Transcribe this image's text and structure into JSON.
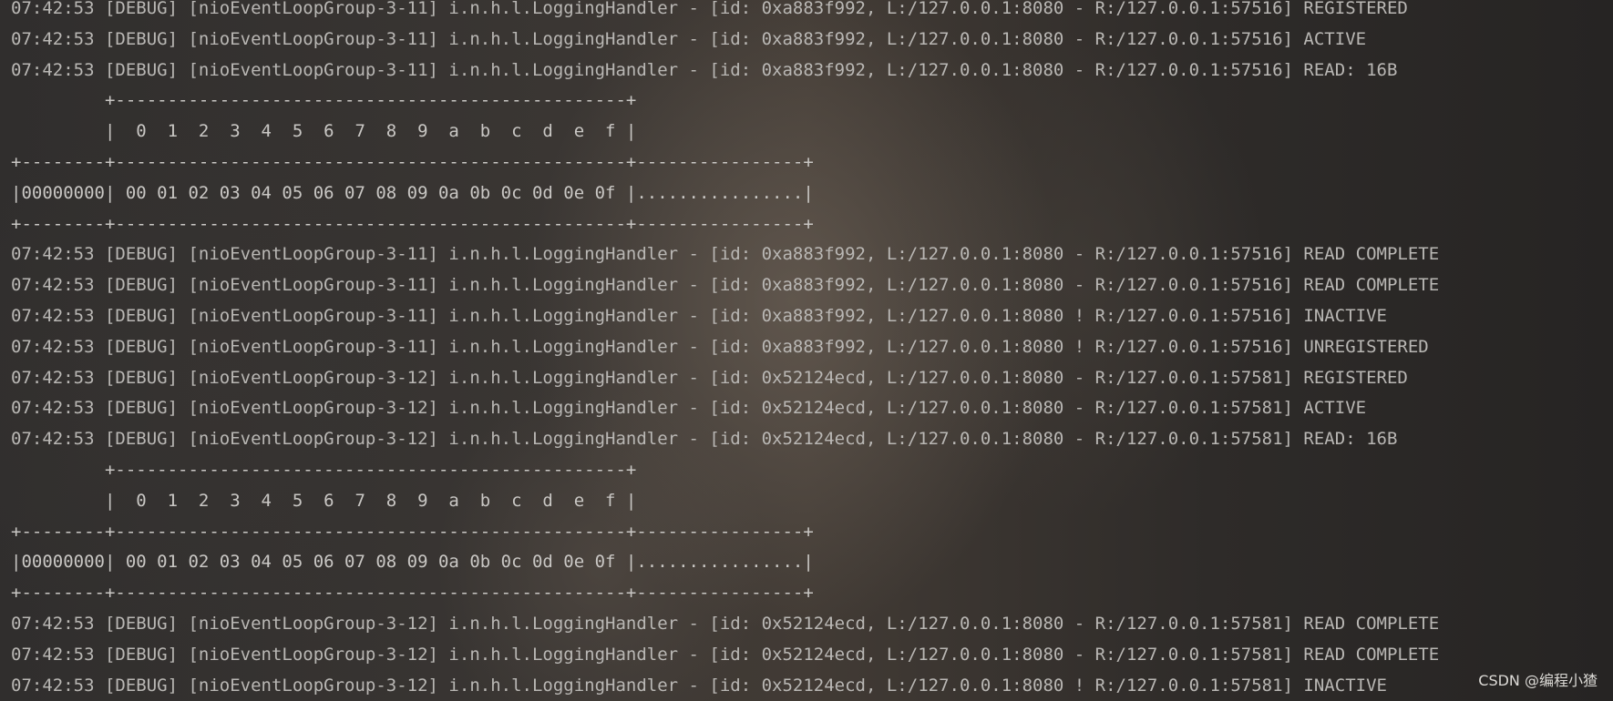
{
  "console": {
    "lines": [
      "07:42:53 [DEBUG] [nioEventLoopGroup-3-11] i.n.h.l.LoggingHandler - [id: 0xa883f992, L:/127.0.0.1:8080 - R:/127.0.0.1:57516] REGISTERED",
      "07:42:53 [DEBUG] [nioEventLoopGroup-3-11] i.n.h.l.LoggingHandler - [id: 0xa883f992, L:/127.0.0.1:8080 - R:/127.0.0.1:57516] ACTIVE",
      "07:42:53 [DEBUG] [nioEventLoopGroup-3-11] i.n.h.l.LoggingHandler - [id: 0xa883f992, L:/127.0.0.1:8080 - R:/127.0.0.1:57516] READ: 16B",
      "         +-------------------------------------------------+",
      "         |  0  1  2  3  4  5  6  7  8  9  a  b  c  d  e  f |",
      "+--------+-------------------------------------------------+----------------+",
      "|00000000| 00 01 02 03 04 05 06 07 08 09 0a 0b 0c 0d 0e 0f |................|",
      "+--------+-------------------------------------------------+----------------+",
      "07:42:53 [DEBUG] [nioEventLoopGroup-3-11] i.n.h.l.LoggingHandler - [id: 0xa883f992, L:/127.0.0.1:8080 - R:/127.0.0.1:57516] READ COMPLETE",
      "07:42:53 [DEBUG] [nioEventLoopGroup-3-11] i.n.h.l.LoggingHandler - [id: 0xa883f992, L:/127.0.0.1:8080 - R:/127.0.0.1:57516] READ COMPLETE",
      "07:42:53 [DEBUG] [nioEventLoopGroup-3-11] i.n.h.l.LoggingHandler - [id: 0xa883f992, L:/127.0.0.1:8080 ! R:/127.0.0.1:57516] INACTIVE",
      "07:42:53 [DEBUG] [nioEventLoopGroup-3-11] i.n.h.l.LoggingHandler - [id: 0xa883f992, L:/127.0.0.1:8080 ! R:/127.0.0.1:57516] UNREGISTERED",
      "07:42:53 [DEBUG] [nioEventLoopGroup-3-12] i.n.h.l.LoggingHandler - [id: 0x52124ecd, L:/127.0.0.1:8080 - R:/127.0.0.1:57581] REGISTERED",
      "07:42:53 [DEBUG] [nioEventLoopGroup-3-12] i.n.h.l.LoggingHandler - [id: 0x52124ecd, L:/127.0.0.1:8080 - R:/127.0.0.1:57581] ACTIVE",
      "07:42:53 [DEBUG] [nioEventLoopGroup-3-12] i.n.h.l.LoggingHandler - [id: 0x52124ecd, L:/127.0.0.1:8080 - R:/127.0.0.1:57581] READ: 16B",
      "         +-------------------------------------------------+",
      "         |  0  1  2  3  4  5  6  7  8  9  a  b  c  d  e  f |",
      "+--------+-------------------------------------------------+----------------+",
      "|00000000| 00 01 02 03 04 05 06 07 08 09 0a 0b 0c 0d 0e 0f |................|",
      "+--------+-------------------------------------------------+----------------+",
      "07:42:53 [DEBUG] [nioEventLoopGroup-3-12] i.n.h.l.LoggingHandler - [id: 0x52124ecd, L:/127.0.0.1:8080 - R:/127.0.0.1:57581] READ COMPLETE",
      "07:42:53 [DEBUG] [nioEventLoopGroup-3-12] i.n.h.l.LoggingHandler - [id: 0x52124ecd, L:/127.0.0.1:8080 - R:/127.0.0.1:57581] READ COMPLETE",
      "07:42:53 [DEBUG] [nioEventLoopGroup-3-12] i.n.h.l.LoggingHandler - [id: 0x52124ecd, L:/127.0.0.1:8080 ! R:/127.0.0.1:57581] INACTIVE"
    ]
  },
  "watermark": "CSDN @编程小猹",
  "colors": {
    "text": "#b9b7b4",
    "background": "#2a2827"
  }
}
